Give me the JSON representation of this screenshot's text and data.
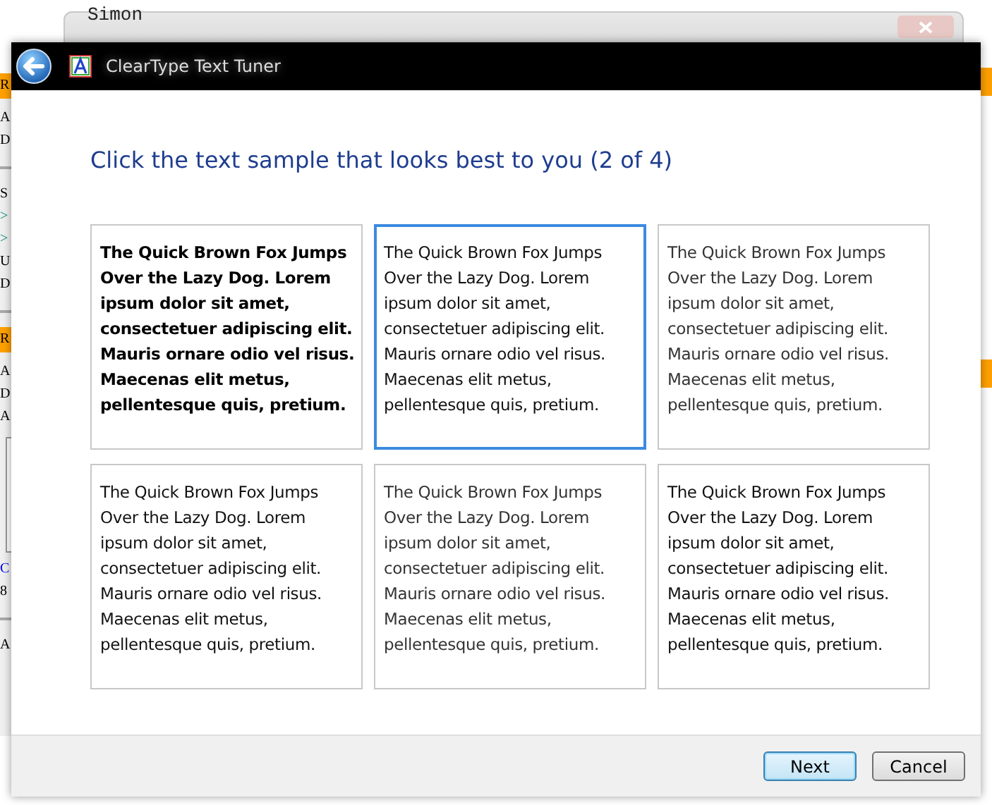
{
  "background_page": {
    "behind_window": {
      "text": "Simon"
    },
    "left_fragments": [
      {
        "kind": "header",
        "text": "R"
      },
      {
        "kind": "text",
        "text": "A"
      },
      {
        "kind": "text",
        "text": "D"
      },
      {
        "kind": "rule"
      },
      {
        "kind": "text",
        "text": "S"
      },
      {
        "kind": "arrow",
        "text": ">"
      },
      {
        "kind": "arrow",
        "text": ">"
      },
      {
        "kind": "text",
        "text": "U"
      },
      {
        "kind": "text",
        "text": "D"
      },
      {
        "kind": "rule"
      },
      {
        "kind": "header",
        "text": "R"
      },
      {
        "kind": "text",
        "text": "A"
      },
      {
        "kind": "text",
        "text": "D"
      },
      {
        "kind": "text",
        "text": "A"
      },
      {
        "kind": "thumb"
      },
      {
        "kind": "link",
        "text": "C"
      },
      {
        "kind": "text",
        "text": "8"
      },
      {
        "kind": "rule"
      },
      {
        "kind": "text",
        "text": "A"
      }
    ]
  },
  "dialog": {
    "title": "ClearType Text Tuner",
    "heading": "Click the text sample that looks best to you (2 of 4)",
    "samples": [
      {
        "text": "The Quick Brown Fox Jumps Over the Lazy Dog. Lorem ipsum dolor sit amet, consectetuer adipiscing elit. Mauris ornare odio vel risus. Maecenas elit metus, pellentesque quis, pretium.",
        "kind": "heavy",
        "selected": false
      },
      {
        "text": "The Quick Brown Fox Jumps Over the Lazy Dog. Lorem ipsum dolor sit amet, consectetuer adipiscing elit. Mauris ornare odio vel risus. Maecenas elit metus, pellentesque quis, pretium.",
        "kind": "regular",
        "selected": true
      },
      {
        "text": "The Quick Brown Fox Jumps Over the Lazy Dog. Lorem ipsum dolor sit amet, consectetuer adipiscing elit. Mauris ornare odio vel risus. Maecenas elit metus, pellentesque quis, pretium.",
        "kind": "light",
        "selected": false
      },
      {
        "text": "The Quick Brown Fox Jumps Over the Lazy Dog. Lorem ipsum dolor sit amet, consectetuer adipiscing elit. Mauris ornare odio vel risus. Maecenas elit metus, pellentesque quis, pretium.",
        "kind": "regular",
        "selected": false
      },
      {
        "text": "The Quick Brown Fox Jumps Over the Lazy Dog. Lorem ipsum dolor sit amet, consectetuer adipiscing elit. Mauris ornare odio vel risus. Maecenas elit metus, pellentesque quis, pretium.",
        "kind": "light",
        "selected": false
      },
      {
        "text": "The Quick Brown Fox Jumps Over the Lazy Dog. Lorem ipsum dolor sit amet, consectetuer adipiscing elit. Mauris ornare odio vel risus. Maecenas elit metus, pellentesque quis, pretium.",
        "kind": "regular",
        "selected": false
      }
    ],
    "buttons": [
      {
        "label": "Next",
        "default": true
      },
      {
        "label": "Cancel",
        "default": false
      }
    ]
  }
}
